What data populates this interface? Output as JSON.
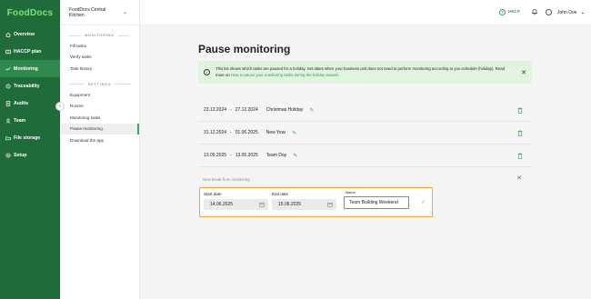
{
  "brand": {
    "logo": "FoodDocs",
    "accent": "#1f6b3a"
  },
  "nav": {
    "items": [
      {
        "label": "Overview",
        "icon": "overview-icon"
      },
      {
        "label": "HACCP plan",
        "icon": "haccp-icon"
      },
      {
        "label": "Monitoring",
        "icon": "monitoring-icon",
        "active": true
      },
      {
        "label": "Traceability",
        "icon": "traceability-icon"
      },
      {
        "label": "Audits",
        "icon": "audits-icon"
      },
      {
        "label": "Team",
        "icon": "team-icon"
      },
      {
        "label": "File storage",
        "icon": "file-storage-icon"
      },
      {
        "label": "Setup",
        "icon": "setup-icon"
      }
    ]
  },
  "sidebar": {
    "business_unit": "FoodDocs Central Kitchen",
    "monitoring_section": "MONITORING",
    "monitoring_items": [
      "Fill tasks",
      "Verify tasks",
      "Task history"
    ],
    "settings_section": "SETTINGS",
    "settings_items": [
      "Equipment",
      "Rooms",
      "Monitoring tasks",
      "Pause monitoring",
      "Download the app"
    ],
    "active_item": "Pause monitoring"
  },
  "topbar": {
    "help_label": "HELP",
    "user_name": "John Doe"
  },
  "main": {
    "title": "Pause monitoring",
    "info_text": "This list shows which tasks are paused for a holiday. Set dates when your business unit does not need to perform monitoring according to you schedule (holiday). Read more on",
    "info_link": "How to pause your monitoring tasks during the holiday season.",
    "breaks": [
      {
        "start": "23.12.2024",
        "end": "27.12.2024",
        "name": "Christmas Holiday"
      },
      {
        "start": "31.12.2024",
        "end": "01.06.2025",
        "name": "New Year"
      },
      {
        "start": "13.05.2025",
        "end": "13.05.2025",
        "name": "Team Day"
      }
    ],
    "separator": "-",
    "new_break_label": "New break from monitoring",
    "form": {
      "start_label": "Start date",
      "start_value": "14.06.2025",
      "end_label": "End date",
      "end_value": "15.06.2025",
      "name_label": "Name",
      "name_value": "Team Building Weekend"
    }
  }
}
